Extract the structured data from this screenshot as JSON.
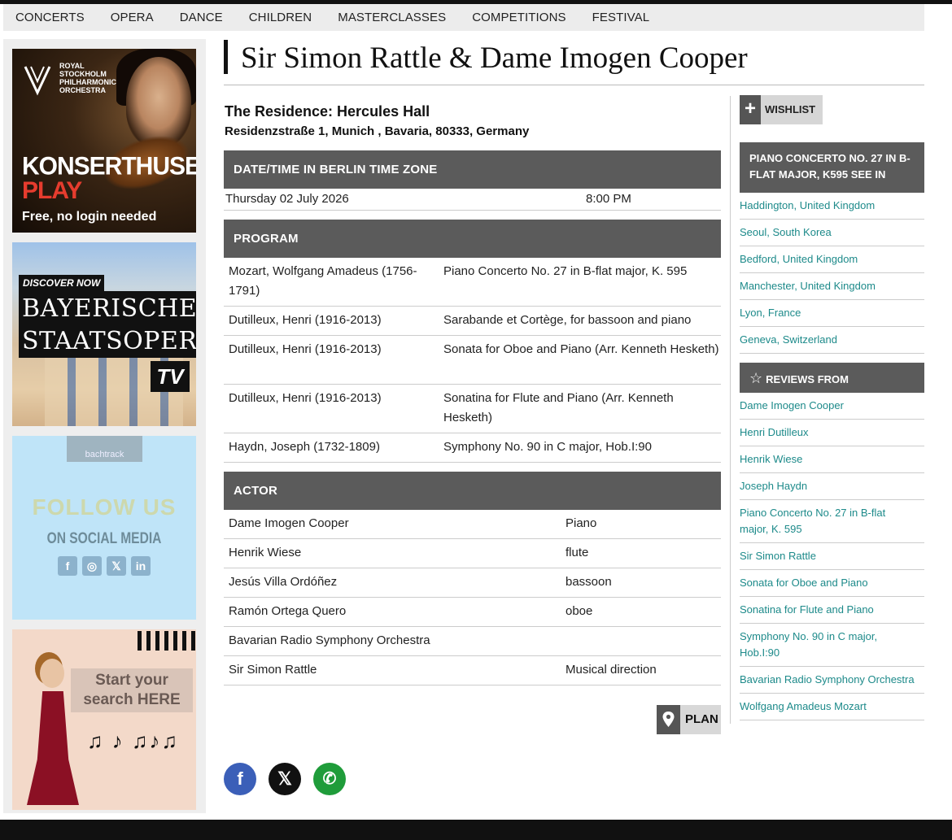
{
  "nav": {
    "items": [
      "CONCERTS",
      "OPERA",
      "DANCE",
      "CHILDREN",
      "MASTERCLASSES",
      "COMPETITIONS",
      "FESTIVAL"
    ]
  },
  "ads": {
    "konserthuset": {
      "org_lines": [
        "ROYAL",
        "STOCKHOLM",
        "PHILHARMONIC",
        "ORCHESTRA"
      ],
      "brand_line1": "KONSERTHUSET",
      "brand_line2": "PLAY",
      "tagline": "Free, no login needed"
    },
    "bayerische": {
      "badge": "DISCOVER NOW",
      "line1": "BAYERISCHE",
      "line2": "STAATSOPER",
      "tv": "TV"
    },
    "bachtrack": {
      "logo": "bachtrack",
      "follow": "FOLLOW US",
      "social": "ON SOCIAL MEDIA",
      "icons": [
        "f",
        "◎",
        "𝕏",
        "in"
      ]
    },
    "search": {
      "line1": "Start your",
      "line2": "search HERE",
      "notes": "♫ ♪ ♫♪♫"
    }
  },
  "event": {
    "title": "Sir Simon Rattle & Dame Imogen Cooper",
    "venue_name": "The Residence: Hercules Hall",
    "venue_address": "Residenzstraße 1, Munich , Bavaria, 80333, Germany"
  },
  "datetime": {
    "heading": "DATE/TIME IN BERLIN TIME ZONE",
    "date": "Thursday 02 July 2026",
    "time": "8:00 PM"
  },
  "program": {
    "heading": "PROGRAM",
    "rows": [
      {
        "composer": "Mozart, Wolfgang Amadeus (1756-1791)",
        "work": "Piano Concerto No. 27 in B-flat major, K. 595"
      },
      {
        "composer": "Dutilleux, Henri (1916-2013)",
        "work": "Sarabande et Cortège, for bassoon and piano"
      },
      {
        "composer": "Dutilleux, Henri (1916-2013)",
        "work": "Sonata for Oboe and Piano (Arr. Kenneth Hesketh)"
      },
      {
        "composer": "Dutilleux, Henri (1916-2013)",
        "work": "Sonatina for Flute and Piano (Arr. Kenneth Hesketh)"
      },
      {
        "composer": "Haydn, Joseph (1732-1809)",
        "work": "Symphony No. 90 in C major, Hob.I:90"
      }
    ]
  },
  "actor": {
    "heading": "ACTOR",
    "rows": [
      {
        "name": "Dame Imogen Cooper",
        "role": "Piano"
      },
      {
        "name": "Henrik Wiese",
        "role": "flute"
      },
      {
        "name": "Jesús Villa Ordóñez",
        "role": "bassoon"
      },
      {
        "name": "Ramón Ortega Quero",
        "role": "oboe"
      },
      {
        "name": "Bavarian Radio Symphony Orchestra",
        "role": ""
      },
      {
        "name": "Sir Simon Rattle",
        "role": "Musical direction"
      }
    ]
  },
  "plan": {
    "label": "PLAN"
  },
  "share": {
    "facebook": "f",
    "x": "𝕏",
    "whatsapp": "✆"
  },
  "sidebar": {
    "wishlist_label": "WISHLIST",
    "see_in_heading": "PIANO CONCERTO NO. 27 IN B-FLAT MAJOR, K595 SEE IN",
    "see_in_links": [
      "Haddington, United Kingdom",
      "Seoul, South Korea",
      "Bedford, United Kingdom",
      "Manchester, United Kingdom",
      "Lyon, France",
      "Geneva, Switzerland"
    ],
    "reviews_heading": "REVIEWS FROM",
    "reviews_links": [
      "Dame Imogen Cooper",
      "Henri Dutilleux",
      "Henrik Wiese",
      "Joseph Haydn",
      "Piano Concerto No. 27 in B-flat major, K. 595",
      "Sir Simon Rattle",
      "Sonata for Oboe and Piano",
      "Sonatina for Flute and Piano",
      "Symphony No. 90 in C major, Hob.I:90",
      "Bavarian Radio Symphony Orchestra",
      "Wolfgang Amadeus Mozart"
    ]
  },
  "colors": {
    "section_header": "#5b5b5b",
    "link": "#1d8a8a",
    "facebook": "#3b5fb8",
    "whatsapp": "#1f9c3a"
  }
}
